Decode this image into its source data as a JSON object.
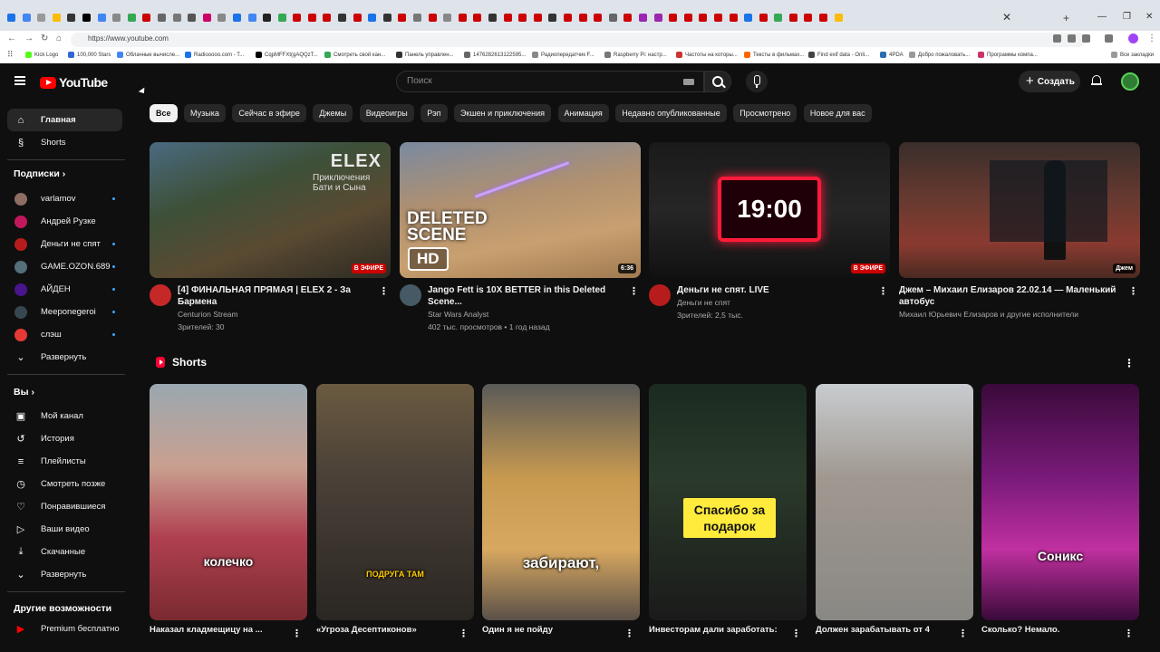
{
  "browser": {
    "url": "https://www.youtube.com",
    "bookmarks": [
      {
        "label": "Kick Logo",
        "color": "#53fc18"
      },
      {
        "label": "100,000 Stars",
        "color": "#3367d6"
      },
      {
        "label": "Облачные вычисле...",
        "color": "#4285f4"
      },
      {
        "label": "Radiooooo.com - T...",
        "color": "#1a73e8"
      },
      {
        "label": "CqpMFFXt(gAQQzT...",
        "color": "#000000"
      },
      {
        "label": "Смотреть свой кан...",
        "color": "#34a853"
      },
      {
        "label": "Панель управлен...",
        "color": "#333333"
      },
      {
        "label": "1476282613122595...",
        "color": "#666666"
      },
      {
        "label": "Радиопередатчик F...",
        "color": "#888888"
      },
      {
        "label": "Raspberry Pi: настр...",
        "color": "#777777"
      },
      {
        "label": "Частоты на которы...",
        "color": "#cc3333"
      },
      {
        "label": "Тексты в фильмах...",
        "color": "#ff6600"
      },
      {
        "label": "Find exif data - Onli...",
        "color": "#444444"
      },
      {
        "label": "4PDA",
        "color": "#2b6cb0"
      },
      {
        "label": "Добро пожаловать...",
        "color": "#999999"
      },
      {
        "label": "Программы компа...",
        "color": "#cc3366"
      }
    ],
    "all_bookmarks_label": "Все закладки",
    "tab_colors": [
      "#1a73e8",
      "#4285f4",
      "#999999",
      "#fbbc05",
      "#333333",
      "#000000",
      "#4285f4",
      "#888888",
      "#34a853",
      "#cc0000",
      "#666666",
      "#777777",
      "#555555",
      "#cc0066",
      "#888888",
      "#1a73e8",
      "#4285f4",
      "#222222",
      "#34a853",
      "#cc0000",
      "#cc0000",
      "#cc0000",
      "#333333",
      "#cc0000",
      "#1a73e8",
      "#333333",
      "#cc0000",
      "#777777",
      "#cc0000",
      "#888888",
      "#cc0000",
      "#cc0000",
      "#333333",
      "#cc0000",
      "#cc0000",
      "#cc0000",
      "#333333",
      "#cc0000",
      "#cc0000",
      "#cc0000",
      "#666666",
      "#cc0000",
      "#9b27b0",
      "#9b27b0",
      "#cc0000",
      "#cc0000",
      "#cc0000",
      "#cc0000",
      "#cc0000",
      "#1a73e8",
      "#cc0000",
      "#34a853",
      "#cc0000",
      "#cc0000",
      "#cc0000",
      "#fbbc05"
    ]
  },
  "header": {
    "logo_text": "YouTube",
    "search_placeholder": "Поиск",
    "create_label": "Создать"
  },
  "sidebar": {
    "main": [
      {
        "label": "Главная",
        "icon": "home-icon",
        "glyph": "⌂",
        "active": true
      },
      {
        "label": "Shorts",
        "icon": "shorts-icon",
        "glyph": "§",
        "active": false
      }
    ],
    "subscriptions_title": "Подписки",
    "subscriptions": [
      {
        "label": "varlamov",
        "color": "#8d6e63",
        "live": true
      },
      {
        "label": "Андрей Рузке",
        "color": "#c2185b",
        "live": false
      },
      {
        "label": "Деньги не спят",
        "color": "#b71c1c",
        "live": true
      },
      {
        "label": "GAME.OZON.689",
        "color": "#546e7a",
        "live": true
      },
      {
        "label": "АЙДЕН",
        "color": "#4a148c",
        "live": true
      },
      {
        "label": "Meeponegeroi",
        "color": "#37474f",
        "live": true
      },
      {
        "label": "слэш",
        "color": "#e53935",
        "live": true
      }
    ],
    "subscriptions_expand": "Развернуть",
    "you_title": "Вы",
    "you_items": [
      {
        "label": "Мой канал",
        "icon": "my-channel-icon",
        "glyph": "▣"
      },
      {
        "label": "История",
        "icon": "history-icon",
        "glyph": "↺"
      },
      {
        "label": "Плейлисты",
        "icon": "playlists-icon",
        "glyph": "≡"
      },
      {
        "label": "Смотреть позже",
        "icon": "watch-later-icon",
        "glyph": "◷"
      },
      {
        "label": "Понравившиеся",
        "icon": "liked-icon",
        "glyph": "♡"
      },
      {
        "label": "Ваши видео",
        "icon": "your-videos-icon",
        "glyph": "▷"
      },
      {
        "label": "Скачанные",
        "icon": "downloads-icon",
        "glyph": "⤓"
      }
    ],
    "you_expand": "Развернуть",
    "more_title": "Другие возможности",
    "premium_label": "Premium бесплатно"
  },
  "chips": [
    "Все",
    "Музыка",
    "Сейчас в эфире",
    "Джемы",
    "Видеоигры",
    "Рэп",
    "Экшен и приключения",
    "Анимация",
    "Недавно опубликованные",
    "Просмотрено",
    "Новое для вас"
  ],
  "videos": [
    {
      "title": "[4] ФИНАЛЬНАЯ ПРЯМАЯ | ELEX 2 - За Бармена",
      "channel": "Centurion Stream",
      "stats": "Зрителей: 30",
      "badge": "В ЭФИРЕ",
      "badge_type": "live",
      "thumb_text": "ELEX",
      "thumb_sub": "Приключения Бати и Сына",
      "thumb_bg": "linear-gradient(160deg,#4a6a80 0%,#3d5038 35%,#5a4a32 65%,#2c2a22 100%)",
      "avatar_color": "#c62828"
    },
    {
      "title": "Jango Fett is 10X BETTER in this Deleted Scene...",
      "channel": "Star Wars Analyst",
      "stats": "402 тыс. просмотров • 1 год назад",
      "badge": "6:36",
      "badge_type": "duration",
      "thumb_text": "DELETED SCENE",
      "thumb_sub": "HD",
      "thumb_bg": "linear-gradient(170deg,#7a8aa0 0%,#b09070 40%,#c8a070 70%,#a07a50 100%)",
      "avatar_color": "#455a64"
    },
    {
      "title": "Деньги не спят. LIVE",
      "channel": "Деньги не спят",
      "stats": "Зрителей: 2,5 тыс.",
      "badge": "В ЭФИРЕ",
      "badge_type": "live",
      "thumb_text": "19:00",
      "thumb_sub": "",
      "thumb_bg": "linear-gradient(180deg,#1a1a1a 0%,#262626 50%,#111111 100%)",
      "avatar_color": "#b71c1c"
    },
    {
      "title": "Джем – Михаил Елизаров 22.02.14 — Маленький автобус",
      "channel": "Михаил Юрьевич Елизаров и другие исполнители",
      "stats": "",
      "badge": "Джем",
      "badge_type": "duration",
      "thumb_text": "",
      "thumb_sub": "",
      "thumb_bg": "linear-gradient(180deg,#3a2e2a 0%,#6a3a30 45%,#8a3a30 75%,#4a2a22 100%)",
      "avatar_color": ""
    }
  ],
  "shorts_title": "Shorts",
  "shorts": [
    {
      "title": "Наказал кладмещицу на ...",
      "caption": "колечко",
      "caption_style": "white",
      "bg": "linear-gradient(180deg,#9aa8b0 0%,#c9a090 35%,#b04050 65%,#7a2a30 100%)"
    },
    {
      "title": "«Угроза Десептиконов»",
      "caption": "ПОДРУГА ТАМ",
      "caption_style": "yellow",
      "bg": "linear-gradient(180deg,#6a5a40 0%,#4a4038 40%,#2a2622 100%)"
    },
    {
      "title": "Один я не пойду",
      "caption": "забирают,",
      "caption_style": "white",
      "bg": "linear-gradient(180deg,#5a5a58 0%,#c89a50 40%,#d8a860 70%,#5a5048 100%)"
    },
    {
      "title": "Инвесторам дали заработать:",
      "caption": "Спасибо за подарок",
      "caption_style": "box",
      "bg": "linear-gradient(180deg,#1a2a20 0%,#2a3a2a 40%,#1a1a1a 100%)"
    },
    {
      "title": "Должен зарабатывать от 4",
      "caption": "",
      "caption_style": "none",
      "bg": "linear-gradient(180deg,#c8ccd0 0%,#a09890 40%,#8a8884 100%)"
    },
    {
      "title": "Сколько? Немало.",
      "caption": "Соникс",
      "caption_style": "white",
      "bg": "linear-gradient(180deg,#3a0a3a 0%,#7a1a7a 40%,#c030a0 70%,#3a0a3a 100%)"
    }
  ]
}
